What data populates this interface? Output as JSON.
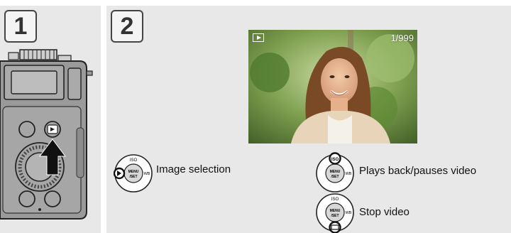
{
  "steps": [
    {
      "number": "1"
    },
    {
      "number": "2"
    }
  ],
  "camera": {
    "icons": [
      "camera-body-icon",
      "playback-button-icon",
      "arrow-up-icon",
      "control-dial-icon"
    ]
  },
  "playback_screen": {
    "frame_counter": "1/999",
    "mode_icon": "playback-icon"
  },
  "controls": [
    {
      "icon": "control-dial-left-highlight-icon",
      "label": "Image selection"
    },
    {
      "icon": "control-dial-up-highlight-icon",
      "label": "Plays back/pauses video"
    },
    {
      "icon": "control-dial-down-highlight-icon",
      "label": "Stop video"
    }
  ],
  "dial_labels": {
    "iso": "ISO",
    "menu": "MENU",
    "set": "/SET",
    "wb": "WB"
  },
  "colors": {
    "panel_bg": "#e8e8e8",
    "camera_body": "#9a9a9a",
    "arrow": "#111111"
  }
}
